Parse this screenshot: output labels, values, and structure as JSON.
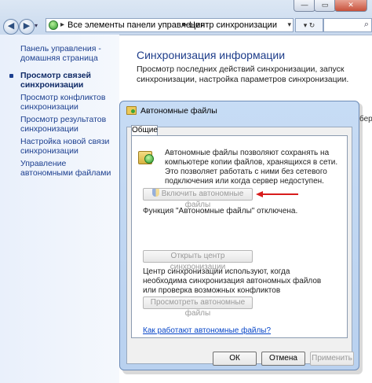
{
  "window": {
    "minimize_glyph": "—",
    "maximize_glyph": "▭",
    "close_glyph": "✕"
  },
  "addressbar": {
    "crumbs": [
      "Все элементы панели управления",
      "Центр синхронизации"
    ],
    "separator": "▸",
    "back_glyph": "◀",
    "forward_glyph": "▶",
    "dropdown_glyph": "▾",
    "refresh_label": "▾ ↻",
    "search_icon": "⌕"
  },
  "sidebar": {
    "items": [
      {
        "label": "Панель управления - домашняя страница"
      },
      {
        "label": "Просмотр связей синхронизации",
        "current": true
      },
      {
        "label": "Просмотр конфликтов синхронизации"
      },
      {
        "label": "Просмотр результатов синхронизации"
      },
      {
        "label": "Настройка новой связи синхронизации"
      },
      {
        "label": "Управление автономными файлами"
      }
    ]
  },
  "main": {
    "title": "Синхронизация информации",
    "description": "Просмотр последних действий синхронизации, запуск синхронизации, настройка параметров синхронизации.",
    "right_fragment": "бери"
  },
  "dialog": {
    "title": "Автономные файлы",
    "tab": "Общие",
    "intro": "Автономные файлы позволяют сохранять на компьютере копии файлов, хранящихся в сети. Это позволяет работать с ними без сетевого подключения или когда сервер недоступен.",
    "enable_button": "Включить автономные файлы",
    "status_text": "Функция \"Автономные файлы\" отключена.",
    "open_sync_center_button": "Открыть центр синхронизации",
    "sync_desc": "Центр синхронизации используют, когда необходима синхронизация автономных файлов или проверка возможных конфликтов синхронизации.",
    "view_files_button": "Просмотреть автономные файлы",
    "help_link": "Как работают автономные файлы?",
    "ok_button": "ОК",
    "cancel_button": "Отмена",
    "apply_button": "Применить"
  },
  "colors": {
    "link": "#0645c8",
    "nav_text": "#1c3f8f",
    "title_blue": "#1e3d8a",
    "arrow_red": "#d81c1c"
  }
}
